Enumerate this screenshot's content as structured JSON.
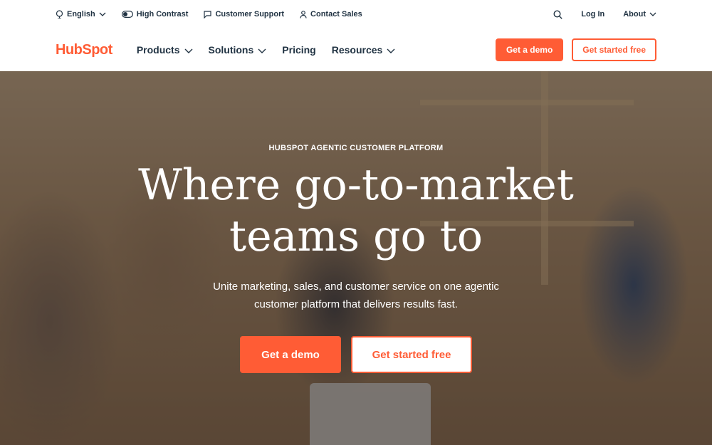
{
  "utility_bar": {
    "language": "English",
    "high_contrast": "High Contrast",
    "support": "Customer Support",
    "sales": "Contact Sales",
    "login": "Log In",
    "about": "About"
  },
  "nav": {
    "logo": "HubSpot",
    "items": [
      {
        "label": "Products",
        "dropdown": true
      },
      {
        "label": "Solutions",
        "dropdown": true
      },
      {
        "label": "Pricing",
        "dropdown": false
      },
      {
        "label": "Resources",
        "dropdown": true
      }
    ],
    "demo_button": "Get a demo",
    "start_button": "Get started free"
  },
  "hero": {
    "eyebrow": "HUBSPOT AGENTIC CUSTOMER PLATFORM",
    "headline_line1": "Where go-to-market",
    "headline_line2": "teams go to",
    "subtext_line1": "Unite marketing, sales, and customer service on one agentic",
    "subtext_line2": "customer platform that delivers results fast.",
    "demo_button": "Get a demo",
    "start_button": "Get started free"
  },
  "colors": {
    "accent": "#ff5c35",
    "text": "#213343"
  }
}
